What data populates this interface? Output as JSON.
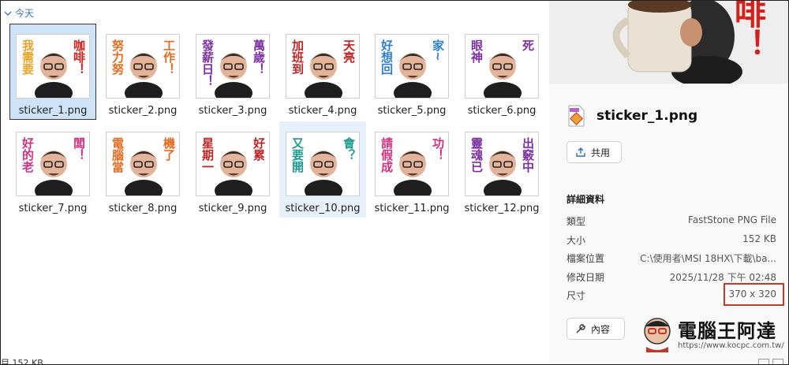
{
  "group": {
    "label": "今天"
  },
  "files": [
    {
      "name": "sticker_1.png",
      "text": "我需要咖啡！",
      "c1": "#e8a325",
      "c2": "#d4201a",
      "state": "selected"
    },
    {
      "name": "sticker_2.png",
      "text": "努力努工作！",
      "c1": "#e56b1f",
      "c2": "#e56b1f",
      "state": ""
    },
    {
      "name": "sticker_3.png",
      "text": "發薪日！萬歲！",
      "c1": "#7b2fa3",
      "c2": "#7b2fa3",
      "state": ""
    },
    {
      "name": "sticker_4.png",
      "text": "加班到天亮",
      "c1": "#c02424",
      "c2": "#c02424",
      "state": ""
    },
    {
      "name": "sticker_5.png",
      "text": "好想回家~",
      "c1": "#2f7fd1",
      "c2": "#2f7fd1",
      "state": ""
    },
    {
      "name": "sticker_6.png",
      "text": "眼神死",
      "c1": "#7b2fa3",
      "c2": "#7b2fa3",
      "state": ""
    },
    {
      "name": "sticker_7.png",
      "text": "好的老闆！",
      "c1": "#d33080",
      "c2": "#d33080",
      "state": ""
    },
    {
      "name": "sticker_8.png",
      "text": "電腦當機了",
      "c1": "#e56b1f",
      "c2": "#e56b1f",
      "state": ""
    },
    {
      "name": "sticker_9.png",
      "text": "星期一好累",
      "c1": "#c02424",
      "c2": "#c02424",
      "state": ""
    },
    {
      "name": "sticker_10.png",
      "text": "又要開會？",
      "c1": "#1f9b8f",
      "c2": "#1f9b8f",
      "state": "hover"
    },
    {
      "name": "sticker_11.png",
      "text": "請假成功！",
      "c1": "#d33080",
      "c2": "#d33080",
      "state": ""
    },
    {
      "name": "sticker_12.png",
      "text": "靈魂已出竅中",
      "c1": "#7b2fa3",
      "c2": "#7b2fa3",
      "state": ""
    }
  ],
  "status": {
    "text": "目 152 KB"
  },
  "details": {
    "file_name": "sticker_1.png",
    "share_label": "共用",
    "section_title": "詳細資料",
    "props": [
      {
        "key": "類型",
        "value": "FastStone PNG File"
      },
      {
        "key": "大小",
        "value": "152 KB"
      },
      {
        "key": "檔案位置",
        "value": "C:\\使用者\\MSI 18HX\\下載\\ba..."
      },
      {
        "key": "修改日期",
        "value": "2025/11/28 下午 02:48"
      },
      {
        "key": "尺寸",
        "value": "370 x 320"
      }
    ],
    "properties_label": "內容",
    "preview_text": "啡！"
  },
  "watermark": {
    "brand": "電腦王阿達",
    "url": "https://www.kocpc.com.tw/"
  },
  "icons": {
    "chevron": "chevron-down-icon",
    "share": "share-icon",
    "wrench": "wrench-icon",
    "file": "png-file-icon"
  }
}
